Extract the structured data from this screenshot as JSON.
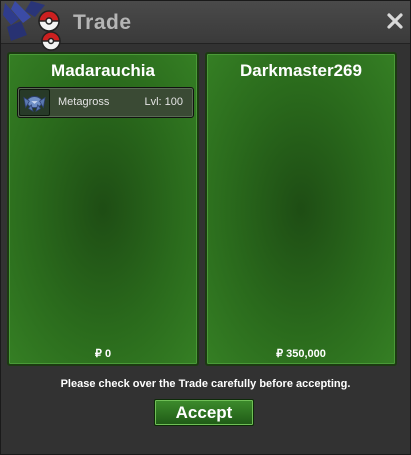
{
  "window": {
    "title": "Trade"
  },
  "left_panel": {
    "player_name": "Madarauchia",
    "pokemon": {
      "name": "Metagross",
      "level_text": "Lvl: 100"
    },
    "money": "₽ 0"
  },
  "right_panel": {
    "player_name": "Darkmaster269",
    "money": "₽ 350,000"
  },
  "notice": "Please check over the Trade carefully before accepting.",
  "buttons": {
    "accept": "Accept"
  },
  "colors": {
    "panel_green": "#2a6a1c",
    "button_green": "#3d8c2c",
    "title_gray": "#b5b5b5"
  }
}
